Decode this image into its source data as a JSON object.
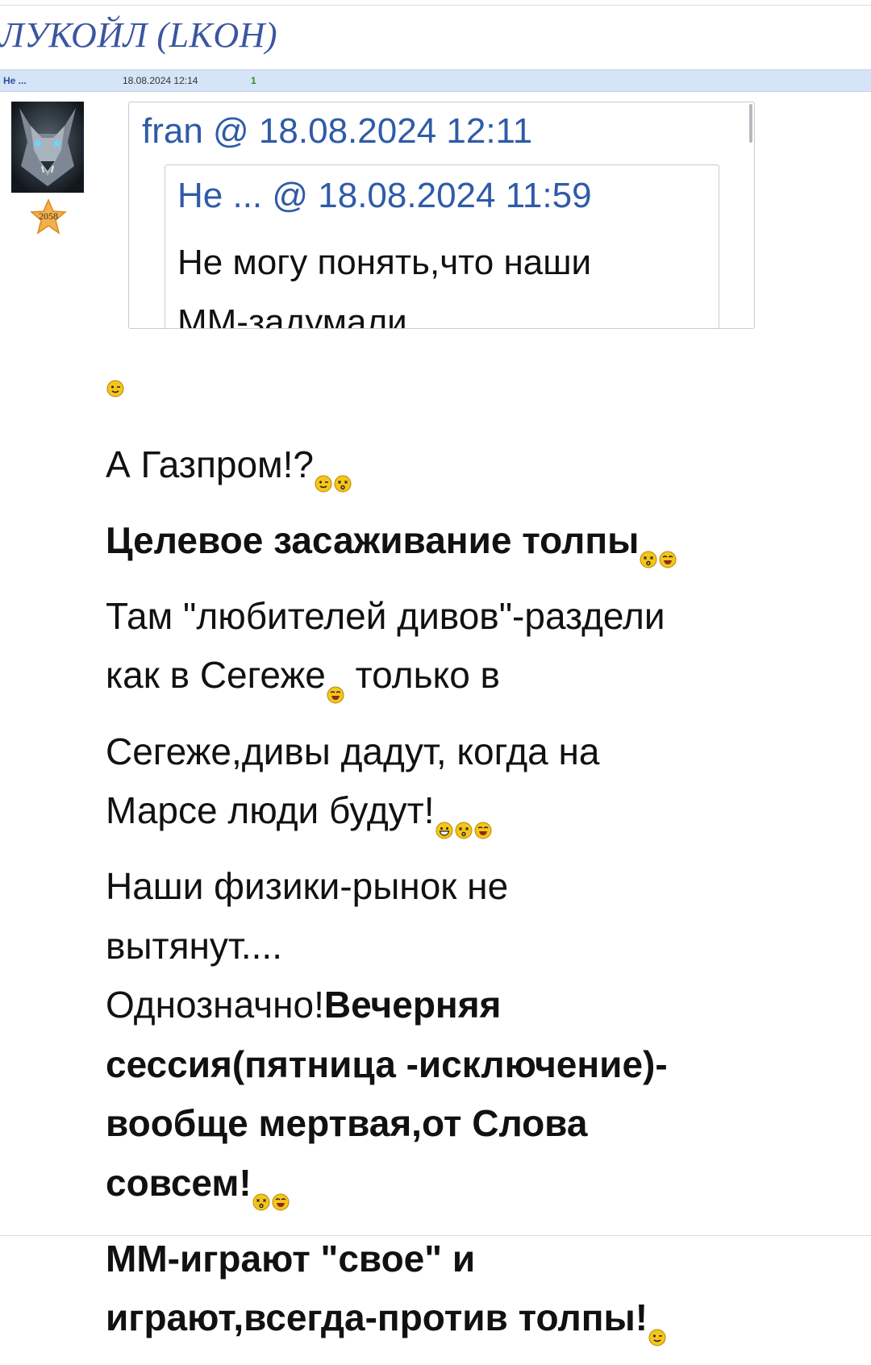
{
  "forum": {
    "title": "ЛУКОЙЛ (LKOH)"
  },
  "post": {
    "author": "Не ...",
    "datetime": "18.08.2024 12:14",
    "number": "1",
    "rating": "2058"
  },
  "quote": {
    "header": "fran @ 18.08.2024 12:11",
    "nested": {
      "header": "Не ... @ 18.08.2024 11:59",
      "line1": "Не могу понять,что наши",
      "line2": "ММ-задумали...."
    }
  },
  "body": {
    "l1": "А Газпром!?",
    "l2": "Целевое засаживание толпы",
    "l3": "Там \"любителей дивов\"-раздели",
    "l4a": "как в Сегеже",
    "l4b": " только в",
    "l5": "Сегеже,дивы дадут, когда на",
    "l6": "Марсе люди будут!",
    "l7": "Наши физики-рынок не",
    "l8": "вытянут....",
    "l9a": "Однозначно!",
    "l9b": "Вечерняя",
    "l10": "сессия(пятница -исключение)-",
    "l11": "вообще мертвая,от Слова",
    "l12": "совсем!",
    "l13": "ММ-играют \"свое\" и",
    "l14": "играют,всегда-против толпы!"
  },
  "icons": {
    "avatar": "wolf-avatar-image",
    "rating": "star-icon",
    "smileys": [
      "wink-smiley-icon",
      "dizzy-smiley-icon",
      "laughing-smiley-icon",
      "grin-smiley-icon"
    ]
  },
  "colors": {
    "title": "#3b55a0",
    "link": "#2f5ba8",
    "bar": "#d6e4f7",
    "star": "#f2a43a",
    "smiley": "#f6c51a"
  }
}
